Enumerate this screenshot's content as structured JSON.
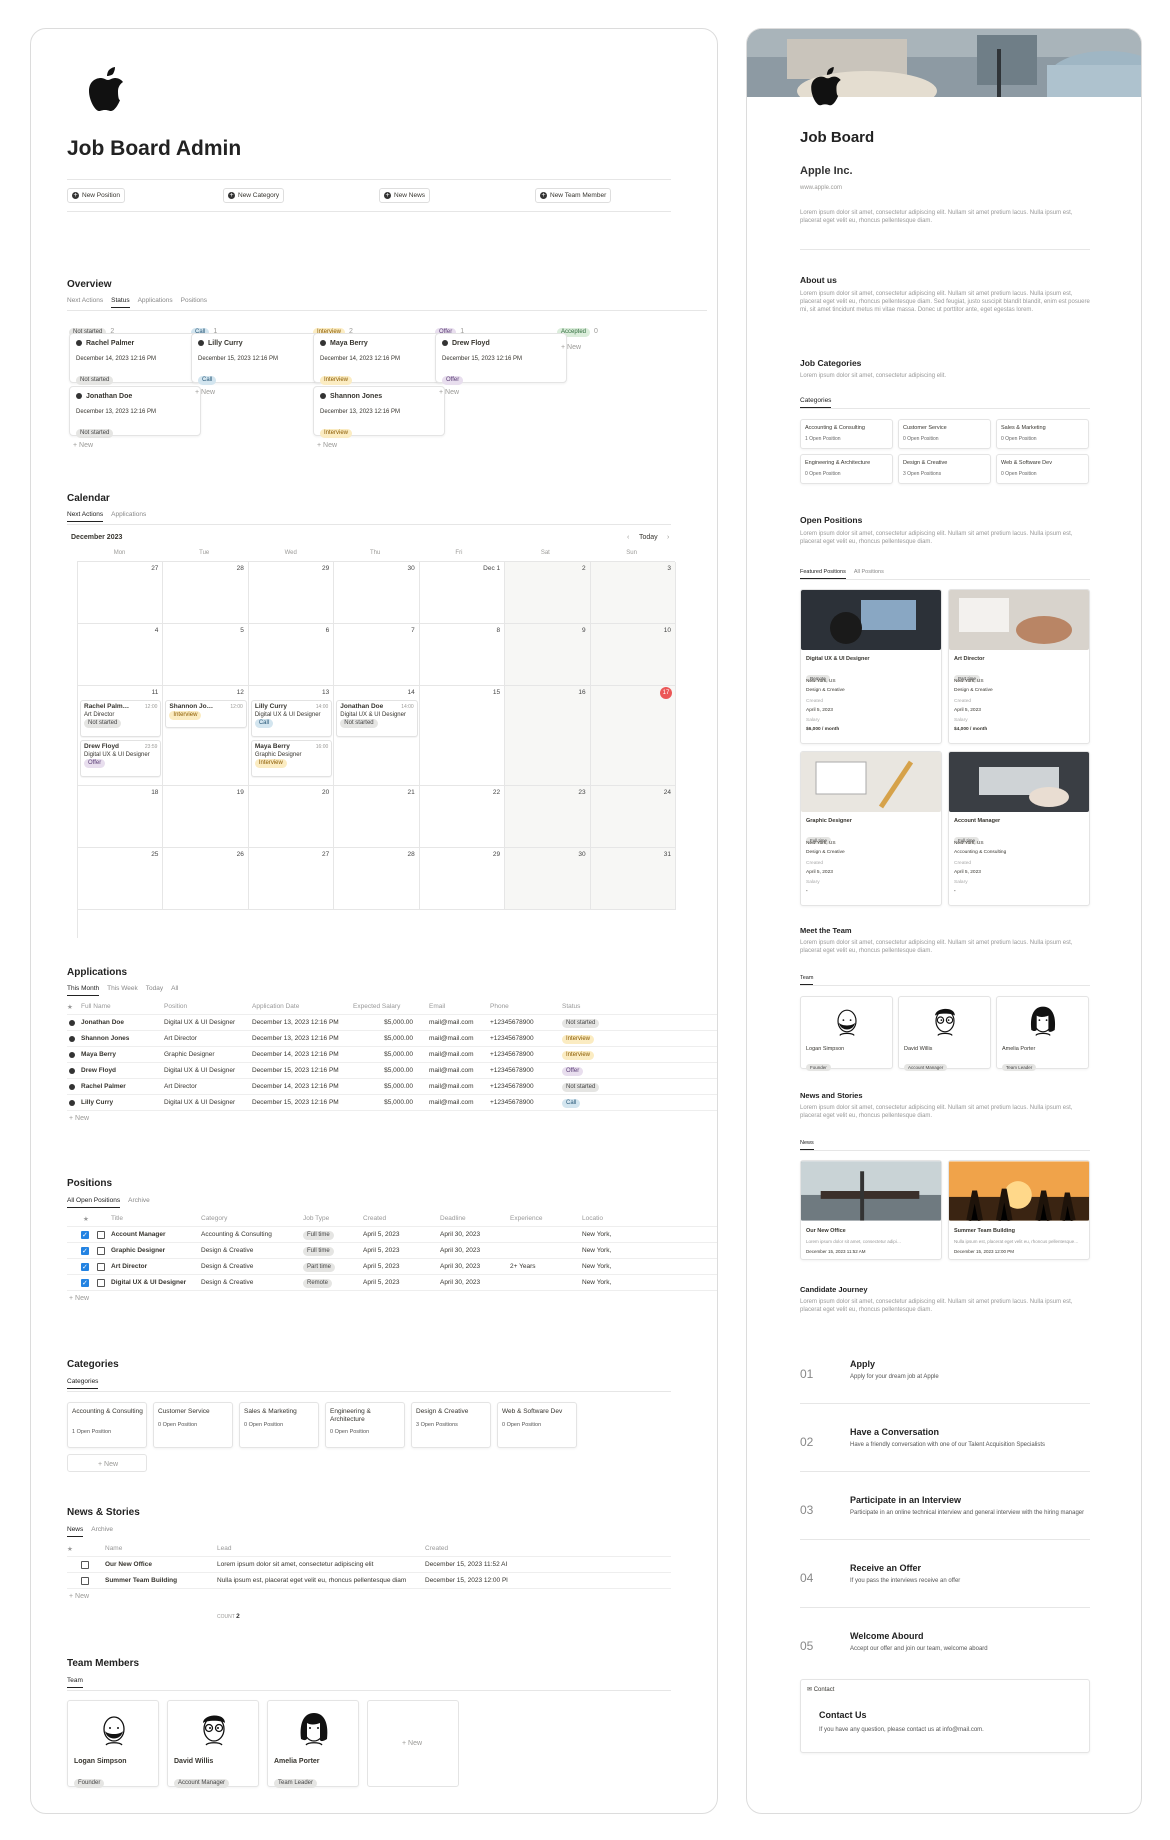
{
  "admin": {
    "title": "Job Board Admin",
    "buttons": [
      "New Position",
      "New Category",
      "New News",
      "New Team Member"
    ],
    "overview": {
      "title": "Overview",
      "tabs": [
        "Next Actions",
        "Status",
        "Applications",
        "Positions"
      ],
      "columns": [
        {
          "label": "Not started",
          "count": "2",
          "cls": "p-ns"
        },
        {
          "label": "Call",
          "count": "1",
          "cls": "p-call"
        },
        {
          "label": "Interview",
          "count": "2",
          "cls": "p-int"
        },
        {
          "label": "Offer",
          "count": "1",
          "cls": "p-off"
        },
        {
          "label": "Accepted",
          "count": "0",
          "cls": "p-acc"
        }
      ],
      "new": "New",
      "cards": [
        {
          "name": "Rachel Palmer",
          "date": "December 14, 2023 12:16 PM",
          "status": "Not started"
        },
        {
          "name": "Jonathan Doe",
          "date": "December 13, 2023 12:16 PM",
          "status": "Not started"
        },
        {
          "name": "Lilly Curry",
          "date": "December 15, 2023 12:16 PM",
          "status": "Call"
        },
        {
          "name": "Maya Berry",
          "date": "December 14, 2023 12:16 PM",
          "status": "Interview"
        },
        {
          "name": "Shannon Jones",
          "date": "December 13, 2023 12:16 PM",
          "status": "Interview"
        },
        {
          "name": "Drew Floyd",
          "date": "December 15, 2023 12:16 PM",
          "status": "Offer"
        }
      ]
    },
    "calendar": {
      "title": "Calendar",
      "tabs": [
        "Next Actions",
        "Applications"
      ],
      "month": "December 2023",
      "today": "Today",
      "weekdays": [
        "Mon",
        "Tue",
        "Wed",
        "Thu",
        "Fri",
        "Sat",
        "Sun"
      ],
      "days": [
        "27",
        "28",
        "29",
        "30",
        "Dec 1",
        "2",
        "3",
        "4",
        "5",
        "6",
        "7",
        "8",
        "9",
        "10",
        "11",
        "12",
        "13",
        "14",
        "15",
        "16",
        "17",
        "18",
        "19",
        "20",
        "21",
        "22",
        "23",
        "24",
        "25",
        "26",
        "27",
        "28",
        "29",
        "30",
        "31"
      ],
      "events": [
        {
          "name": "Rachel Palm…",
          "time": "12:00",
          "role": "Art Director",
          "status": "Not started"
        },
        {
          "name": "Drew Floyd",
          "time": "23:59",
          "role": "Digital UX & UI Designer",
          "status": "Offer"
        },
        {
          "name": "Shannon Jo…",
          "time": "12:00",
          "role": "",
          "status": "Interview"
        },
        {
          "name": "Lilly Curry",
          "time": "14:00",
          "role": "Digital UX & UI Designer",
          "status": "Call"
        },
        {
          "name": "Maya Berry",
          "time": "16:00",
          "role": "Graphic Designer",
          "status": "Interview"
        },
        {
          "name": "Jonathan Doe",
          "time": "14:00",
          "role": "Digital UX & UI Designer",
          "status": "Not started"
        }
      ]
    },
    "applications": {
      "title": "Applications",
      "tabs": [
        "This Month",
        "This Week",
        "Today",
        "All"
      ],
      "headers": [
        "Full Name",
        "Position",
        "Application Date",
        "Expected Salary",
        "Email",
        "Phone",
        "Status"
      ],
      "rows": [
        [
          "Jonathan Doe",
          "Digital UX & UI Designer",
          "December 13, 2023 12:16 PM",
          "$5,000.00",
          "mail@mail.com",
          "+12345678900",
          "Not started"
        ],
        [
          "Shannon Jones",
          "Art Director",
          "December 13, 2023 12:16 PM",
          "$5,000.00",
          "mail@mail.com",
          "+12345678900",
          "Interview"
        ],
        [
          "Maya Berry",
          "Graphic Designer",
          "December 14, 2023 12:16 PM",
          "$5,000.00",
          "mail@mail.com",
          "+12345678900",
          "Interview"
        ],
        [
          "Drew Floyd",
          "Digital UX & UI Designer",
          "December 15, 2023 12:16 PM",
          "$5,000.00",
          "mail@mail.com",
          "+12345678900",
          "Offer"
        ],
        [
          "Rachel Palmer",
          "Art Director",
          "December 14, 2023 12:16 PM",
          "$5,000.00",
          "mail@mail.com",
          "+12345678900",
          "Not started"
        ],
        [
          "Lilly Curry",
          "Digital UX & UI Designer",
          "December 15, 2023 12:16 PM",
          "$5,000.00",
          "mail@mail.com",
          "+12345678900",
          "Call"
        ]
      ],
      "new": "New"
    },
    "positions": {
      "title": "Positions",
      "tabs": [
        "All Open Positions",
        "Archive"
      ],
      "headers": [
        "Title",
        "Category",
        "Job Type",
        "Created",
        "Deadline",
        "Experience",
        "Locatio"
      ],
      "rows": [
        [
          "Account Manager",
          "Accounting & Consulting",
          "Full time",
          "April 5, 2023",
          "April 30, 2023",
          "",
          "New York,"
        ],
        [
          "Graphic Designer",
          "Design & Creative",
          "Full time",
          "April 5, 2023",
          "April 30, 2023",
          "",
          "New York,"
        ],
        [
          "Art Director",
          "Design & Creative",
          "Part time",
          "April 5, 2023",
          "April 30, 2023",
          "2+ Years",
          "New York,"
        ],
        [
          "Digital UX & UI Designer",
          "Design & Creative",
          "Remote",
          "April 5, 2023",
          "April 30, 2023",
          "",
          "New York,"
        ]
      ],
      "new": "New"
    },
    "categories": {
      "title": "Categories",
      "tab": "Categories",
      "items": [
        {
          "name": "Accounting & Consulting",
          "count": "1 Open Position"
        },
        {
          "name": "Customer Service",
          "count": "0 Open Position"
        },
        {
          "name": "Sales & Marketing",
          "count": "0 Open Position"
        },
        {
          "name": "Engineering & Architecture",
          "count": "0 Open Position"
        },
        {
          "name": "Design & Creative",
          "count": "3 Open Positions"
        },
        {
          "name": "Web & Software Dev",
          "count": "0 Open Position"
        }
      ],
      "new": "New"
    },
    "news": {
      "title": "News & Stories",
      "tabs": [
        "News",
        "Archive"
      ],
      "headers": [
        "Name",
        "Lead",
        "Created"
      ],
      "rows": [
        [
          "Our New Office",
          "Lorem ipsum dolor sit amet, consectetur adipiscing elit",
          "December 15, 2023 11:52 AI"
        ],
        [
          "Summer Team Building",
          "Nulla ipsum est, placerat eget velit eu, rhoncus pellentesque diam",
          "December 15, 2023 12:00 Pl"
        ]
      ],
      "new": "New",
      "count_label": "COUNT",
      "count": "2"
    },
    "team": {
      "title": "Team Members",
      "tab": "Team",
      "members": [
        {
          "name": "Logan Simpson",
          "role": "Founder"
        },
        {
          "name": "David Willis",
          "role": "Account Manager"
        },
        {
          "name": "Amelia Porter",
          "role": "Team Leader"
        }
      ],
      "new": "New"
    }
  },
  "board": {
    "title": "Job Board",
    "company": "Apple Inc.",
    "url": "www.apple.com",
    "intro": "Lorem ipsum dolor sit amet, consectetur adipiscing elit. Nullam sit amet pretium lacus. Nulla ipsum est, placerat eget velit eu, rhoncus pellentesque diam.",
    "about_title": "About us",
    "about": "Lorem ipsum dolor sit amet, consectetur adipiscing elit. Nullam sit amet pretium lacus. Nulla ipsum est, placerat eget velit eu, rhoncus pellentesque diam. Sed feugiat, justo suscipit blandit blandit, enim est posuere mi, sit amet tincidunt metus mi vitae massa. Donec ut porttitor ante, eget egestas lorem.",
    "jobcat_title": "Job Categories",
    "jobcat_desc": "Lorem ipsum dolor sit amet, consectetur adipiscing elit.",
    "jobcat_tab": "Categories",
    "open_title": "Open Positions",
    "open_desc": "Lorem ipsum dolor sit amet, consectetur adipiscing elit. Nullam sit amet pretium lacus. Nulla ipsum est, placerat eget velit eu, rhoncus pellentesque diam.",
    "open_tabs": [
      "Featured Positions",
      "All Positions"
    ],
    "positions": [
      {
        "title": "Digital UX & UI Designer",
        "type": "Remote",
        "loc": "New York, US",
        "cat": "Design & Creative",
        "created_label": "Created",
        "created": "April 5, 2023",
        "salary_label": "Salary",
        "salary": "$6,000 / month"
      },
      {
        "title": "Art Director",
        "type": "Part time",
        "loc": "New York, US",
        "cat": "Design & Creative",
        "created_label": "Created",
        "created": "April 5, 2023",
        "salary_label": "Salary",
        "salary": "$4,000 / month"
      },
      {
        "title": "Graphic Designer",
        "type": "Full time",
        "loc": "New York, US",
        "cat": "Design & Creative",
        "created_label": "Created",
        "created": "April 5, 2023",
        "salary_label": "Salary",
        "salary": "-"
      },
      {
        "title": "Account Manager",
        "type": "Full time",
        "loc": "New York, US",
        "cat": "Accounting & Consulting",
        "created_label": "Created",
        "created": "April 5, 2023",
        "salary_label": "Salary",
        "salary": "-"
      }
    ],
    "team_title": "Meet the Team",
    "team_desc": "Lorem ipsum dolor sit amet, consectetur adipiscing elit. Nullam sit amet pretium lacus. Nulla ipsum est, placerat eget velit eu, rhoncus pellentesque diam.",
    "team_tab": "Team",
    "news_title": "News and Stories",
    "news_desc": "Lorem ipsum dolor sit amet, consectetur adipiscing elit. Nullam sit amet pretium lacus. Nulla ipsum est, placerat eget velit eu, rhoncus pellentesque diam.",
    "news_tab": "News",
    "news": [
      {
        "title": "Our New Office",
        "lead": "Lorem ipsum dolor sit amet, consectetur adipi…",
        "date": "December 15, 2023 11:52 AM"
      },
      {
        "title": "Summer Team Building",
        "lead": "Nulla ipsum est, placerat eget velit eu, rhoncus pellentesque…",
        "date": "December 15, 2023 12:00 PM"
      }
    ],
    "journey_title": "Candidate Journey",
    "journey_desc": "Lorem ipsum dolor sit amet, consectetur adipiscing elit. Nullam sit amet pretium lacus. Nulla ipsum est, placerat eget velit eu, rhoncus pellentesque diam.",
    "steps": [
      {
        "num": "01",
        "title": "Apply",
        "desc": "Apply for your dream job at Apple"
      },
      {
        "num": "02",
        "title": "Have a Conversation",
        "desc": "Have a friendly conversation with one of our Talent Acquisition Specialists"
      },
      {
        "num": "03",
        "title": "Participate in an Interview",
        "desc": "Participate in an online technical interview and general interview with the hiring manager"
      },
      {
        "num": "04",
        "title": "Receive an Offer",
        "desc": "If you pass the interviews receive an offer"
      },
      {
        "num": "05",
        "title": "Welcome Abourd",
        "desc": "Accept our offer and join our team, welcome aboard"
      }
    ],
    "contact_label": "Contact",
    "contact_title": "Contact Us",
    "contact_desc": "If you have any question, please contact us at info@mail.com."
  }
}
